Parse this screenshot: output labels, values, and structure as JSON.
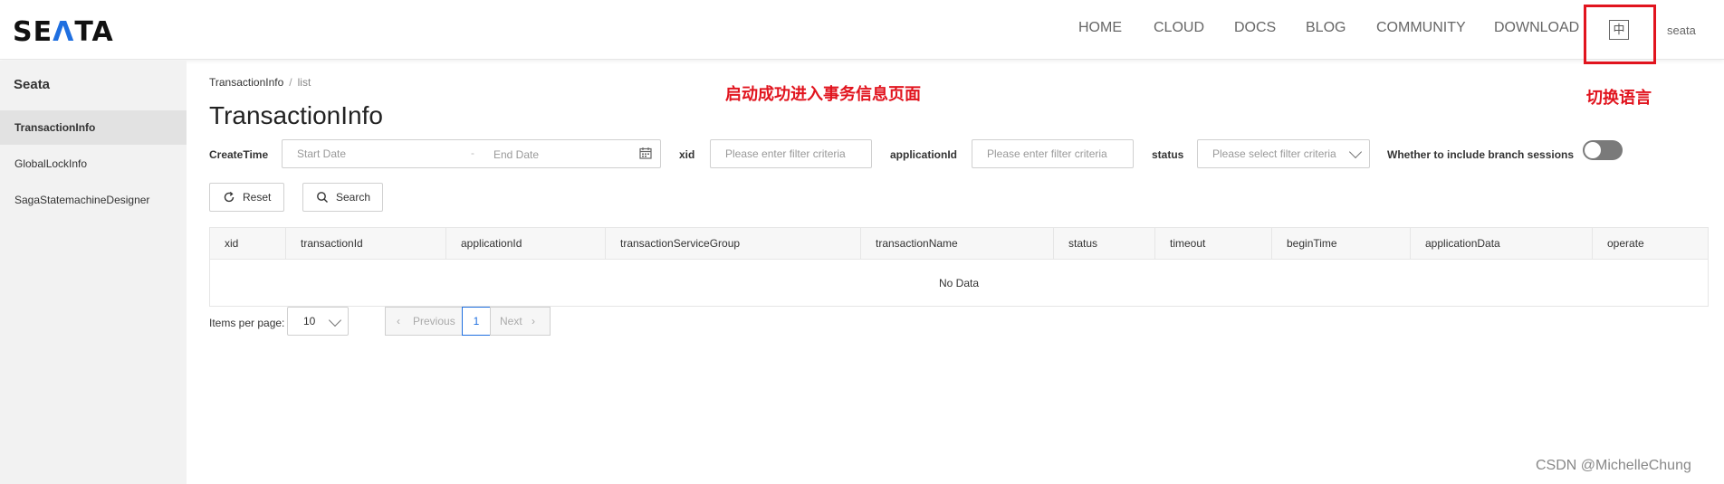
{
  "header": {
    "logo_prefix": "SE",
    "logo_accent": "Λ",
    "logo_suffix": "TA",
    "nav": [
      "HOME",
      "CLOUD",
      "DOCS",
      "BLOG",
      "COMMUNITY",
      "DOWNLOAD"
    ],
    "lang_icon_text": "中",
    "user": "seata"
  },
  "sidebar": {
    "title": "Seata",
    "items": [
      {
        "label": "TransactionInfo",
        "active": true
      },
      {
        "label": "GlobalLockInfo",
        "active": false
      },
      {
        "label": "SagaStatemachineDesigner",
        "active": false
      }
    ]
  },
  "breadcrumb": {
    "parent": "TransactionInfo",
    "separator": "/",
    "current": "list"
  },
  "page_title": "TransactionInfo",
  "annotations": {
    "main_note": "启动成功进入事务信息页面",
    "lang_note": "切换语言",
    "color": "#e1141e"
  },
  "filters": {
    "create_time_label": "CreateTime",
    "start_placeholder": "Start Date",
    "date_separator": "-",
    "end_placeholder": "End Date",
    "xid_label": "xid",
    "xid_placeholder": "Please enter filter criteria",
    "app_label": "applicationId",
    "app_placeholder": "Please enter filter criteria",
    "status_label": "status",
    "status_placeholder": "Please select filter criteria",
    "branch_label": "Whether to include branch sessions",
    "branch_toggle_on": false
  },
  "buttons": {
    "reset": "Reset",
    "search": "Search"
  },
  "table": {
    "columns": [
      "xid",
      "transactionId",
      "applicationId",
      "transactionServiceGroup",
      "transactionName",
      "status",
      "timeout",
      "beginTime",
      "applicationData",
      "operate"
    ],
    "empty_text": "No Data"
  },
  "pagination": {
    "per_page_label": "Items per page:",
    "per_page_value": "10",
    "previous": "Previous",
    "current_page": "1",
    "next": "Next"
  },
  "watermark": "CSDN @MichelleChung",
  "colors": {
    "brand": "#1f6fe0",
    "annotation": "#e1141e"
  }
}
